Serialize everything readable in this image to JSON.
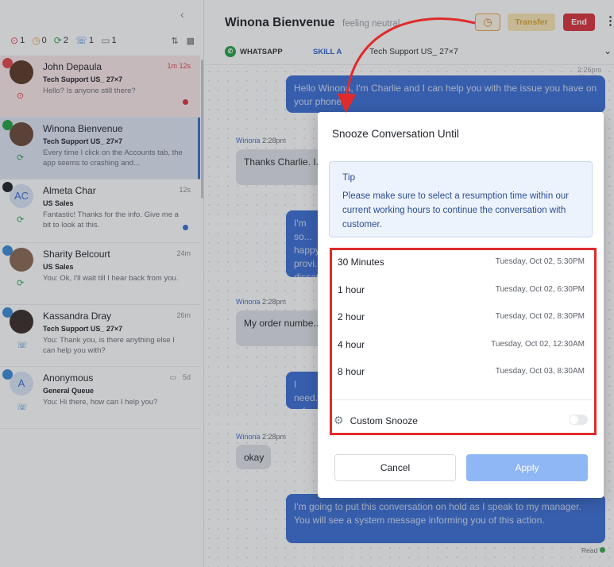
{
  "sidebar": {
    "collapse_glyph": "‹",
    "filters": [
      {
        "icon": "alert-icon",
        "glyph": "⊙",
        "count": "1",
        "color": "#e0474c"
      },
      {
        "icon": "clock-icon",
        "glyph": "◷",
        "count": "0",
        "color": "#e8a44a"
      },
      {
        "icon": "refresh-icon",
        "glyph": "⟳",
        "count": "2",
        "color": "#3aa655"
      },
      {
        "icon": "phone-icon",
        "glyph": "☏",
        "count": "1",
        "color": "#3d8bd4"
      },
      {
        "icon": "chat-icon",
        "glyph": "▭",
        "count": "1",
        "color": "#888888"
      }
    ],
    "sort_glyph": "⇅",
    "grid_glyph": "▦",
    "conversations": [
      {
        "name": "John Depaula",
        "time": "1m 12s",
        "queue": "Tech Support US_ 27×7",
        "preview": "Hello? Is anyone still there?",
        "channel_color": "#e0474c",
        "avatar_color": "#5b3a29",
        "status_glyph": "⊙",
        "status_color": "#e0474c",
        "dot_color": "#d8333d",
        "bg": "#fbe9e9"
      },
      {
        "name": "Winona Bienvenue",
        "time": "",
        "queue": "Tech Support US_ 27×7",
        "preview": "Every time I click on the Accounts tab, the app seems to crashing and...",
        "channel_color": "#25a244",
        "avatar_color": "#6b4a3a",
        "status_glyph": "⟳",
        "status_color": "#3aa655",
        "dot_color": "",
        "bg": "#dfe7f4"
      },
      {
        "name": "Almeta Char",
        "time": "12s",
        "queue": "US Sales",
        "preview": "Fantastic! Thanks for the info. Give me a bit to look at this.",
        "channel_color": "#1f2329",
        "avatar_color": "#dbe6f7",
        "avatar_text": "AC",
        "status_glyph": "⟳",
        "status_color": "#3aa655",
        "dot_color": "#3d6fd4",
        "bg": "#ffffff"
      },
      {
        "name": "Sharity Belcourt",
        "time": "24m",
        "queue": "US Sales",
        "preview": "You: Ok, I'll wait till I hear back from you.",
        "channel_color": "#3d8bd4",
        "avatar_color": "#8a6a55",
        "status_glyph": "⟳",
        "status_color": "#3aa655",
        "dot_color": "",
        "bg": "#ffffff"
      },
      {
        "name": "Kassandra Dray",
        "time": "26m",
        "queue": "Tech Support US_ 27×7",
        "preview": "You: Thank you, is there anything else I can help you with?",
        "channel_color": "#3d8bd4",
        "avatar_color": "#3a2e2a",
        "status_glyph": "☏",
        "status_color": "#3d8bd4",
        "dot_color": "",
        "bg": "#ffffff"
      },
      {
        "name": "Anonymous",
        "time": "5d",
        "queue": "General Queue",
        "preview": "You: Hi there, how can I help you?",
        "channel_color": "#3d8bd4",
        "avatar_color": "#dbe6f7",
        "avatar_text": "A",
        "status_glyph": "☏",
        "status_color": "#3d8bd4",
        "dot_color": "",
        "bg": "#ffffff",
        "time_icon": "▭"
      }
    ]
  },
  "header": {
    "name": "Winona Bienvenue",
    "mood": "feeling neutral",
    "snooze_glyph": "◷",
    "transfer_label": "Transfer",
    "end_label": "End",
    "kebab": "⋮",
    "channel": "WHATSAPP",
    "skill": "SKILL A",
    "queue": "Tech Support US_ 27×7",
    "chevron": "⌄"
  },
  "messages": {
    "top_meta": "2:26pm  Charlie",
    "agent1": "Hello Winona, I'm Charlie and I can help you with the issue you have on your phone.",
    "sender1_name": "Winona",
    "sender1_time": "2:28pm",
    "cust1": "Thanks Charlie. I... and I'm not satisf...",
    "agent2": "I'm so... happy... provi... dissat...",
    "sender2_name": "Winona",
    "sender2_time": "2:28pm",
    "cust2": "My order numbe... product arrived d...",
    "agent3": "I need... refun...",
    "sender3_name": "Winona",
    "sender3_time": "2:28pm",
    "cust3": "okay",
    "agent4": "I'm going to put this conversation on hold as I speak to my manager. You will see a system message informing you of this action.",
    "read": "Read"
  },
  "modal": {
    "title": "Snooze Conversation Until",
    "tip_title": "Tip",
    "tip_text": "Please make sure to select a resumption time within our current working hours to continue the conversation with customer.",
    "options": [
      {
        "label": "30 Minutes",
        "date": "Tuesday, Oct 02, 5:30PM"
      },
      {
        "label": "1 hour",
        "date": "Tuesday, Oct 02, 6:30PM"
      },
      {
        "label": "2 hour",
        "date": "Tuesday, Oct 02, 8:30PM"
      },
      {
        "label": "4 hour",
        "date": "Tuesday, Oct 02, 12:30AM"
      },
      {
        "label": "8 hour",
        "date": "Tuesday, Oct 03, 8:30AM"
      }
    ],
    "custom_label": "Custom Snooze",
    "custom_enabled": false,
    "cancel_label": "Cancel",
    "apply_label": "Apply"
  },
  "colors": {
    "highlight_box": "#e02b2b",
    "arrow": "#e02b2b",
    "apply": "#8fb6f5",
    "accent": "#3d6fd4"
  }
}
